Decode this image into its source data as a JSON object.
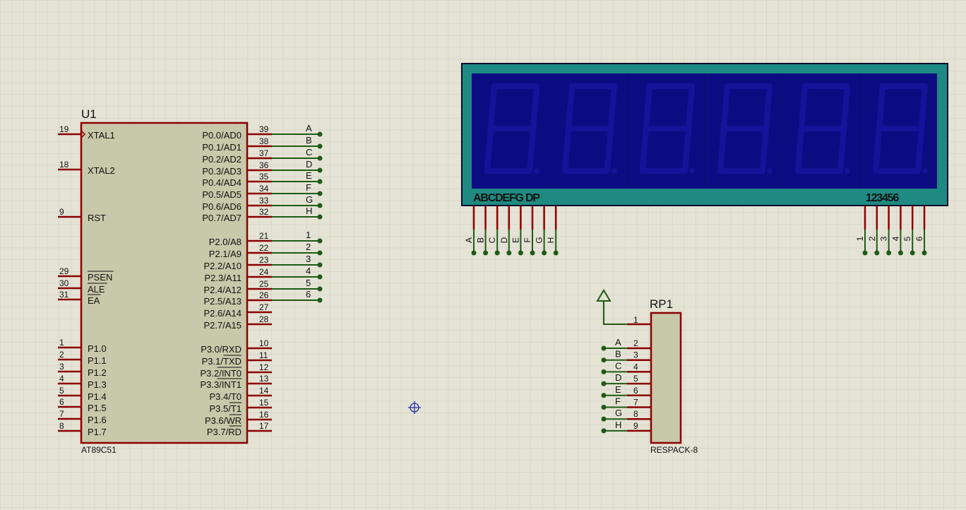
{
  "u1": {
    "ref": "U1",
    "part": "AT89C51",
    "left_pins": [
      {
        "num": "19",
        "name": "XTAL1"
      },
      {
        "num": "18",
        "name": "XTAL2"
      },
      {
        "num": "9",
        "name": "RST"
      },
      {
        "num": "29",
        "name": "PSEN"
      },
      {
        "num": "30",
        "name": "ALE"
      },
      {
        "num": "31",
        "name": "EA"
      },
      {
        "num": "1",
        "name": "P1.0"
      },
      {
        "num": "2",
        "name": "P1.1"
      },
      {
        "num": "3",
        "name": "P1.2"
      },
      {
        "num": "4",
        "name": "P1.3"
      },
      {
        "num": "5",
        "name": "P1.4"
      },
      {
        "num": "6",
        "name": "P1.5"
      },
      {
        "num": "7",
        "name": "P1.6"
      },
      {
        "num": "8",
        "name": "P1.7"
      }
    ],
    "right_pins": [
      {
        "num": "39",
        "name": "P0.0/AD0",
        "net": "A"
      },
      {
        "num": "38",
        "name": "P0.1/AD1",
        "net": "B"
      },
      {
        "num": "37",
        "name": "P0.2/AD2",
        "net": "C"
      },
      {
        "num": "36",
        "name": "P0.3/AD3",
        "net": "D"
      },
      {
        "num": "35",
        "name": "P0.4/AD4",
        "net": "E"
      },
      {
        "num": "34",
        "name": "P0.5/AD5",
        "net": "F"
      },
      {
        "num": "33",
        "name": "P0.6/AD6",
        "net": "G"
      },
      {
        "num": "32",
        "name": "P0.7/AD7",
        "net": "H"
      },
      {
        "num": "21",
        "name": "P2.0/A8",
        "net": "1"
      },
      {
        "num": "22",
        "name": "P2.1/A9",
        "net": "2"
      },
      {
        "num": "23",
        "name": "P2.2/A10",
        "net": "3"
      },
      {
        "num": "24",
        "name": "P2.3/A11",
        "net": "4"
      },
      {
        "num": "25",
        "name": "P2.4/A12",
        "net": "5"
      },
      {
        "num": "26",
        "name": "P2.5/A13",
        "net": "6"
      },
      {
        "num": "27",
        "name": "P2.6/A14",
        "net": ""
      },
      {
        "num": "28",
        "name": "P2.7/A15",
        "net": ""
      },
      {
        "num": "10",
        "name": "P3.0/RXD",
        "net": ""
      },
      {
        "num": "11",
        "name": "P3.1/TXD",
        "net": ""
      },
      {
        "num": "12",
        "name": "P3.2/INT0",
        "net": ""
      },
      {
        "num": "13",
        "name": "P3.3/INT1",
        "net": ""
      },
      {
        "num": "14",
        "name": "P3.4/T0",
        "net": ""
      },
      {
        "num": "15",
        "name": "P3.5/T1",
        "net": ""
      },
      {
        "num": "16",
        "name": "P3.6/WR",
        "net": ""
      },
      {
        "num": "17",
        "name": "P3.7/RD",
        "net": ""
      }
    ]
  },
  "display": {
    "segment_label": "ABCDEFG DP",
    "digit_label": "123456",
    "segment_nets": [
      "A",
      "B",
      "C",
      "D",
      "E",
      "F",
      "G",
      "H"
    ],
    "digit_nets": [
      "1",
      "2",
      "3",
      "4",
      "5",
      "6"
    ],
    "digit_count": 6,
    "colors": {
      "frame": "#1e8a82",
      "face": "#0c0c82",
      "segment": "#14149a"
    }
  },
  "rp1": {
    "ref": "RP1",
    "part": "RESPACK-8",
    "common_pin": "1",
    "pins": [
      {
        "num": "2",
        "net": "A"
      },
      {
        "num": "3",
        "net": "B"
      },
      {
        "num": "4",
        "net": "C"
      },
      {
        "num": "5",
        "net": "D"
      },
      {
        "num": "6",
        "net": "E"
      },
      {
        "num": "7",
        "net": "F"
      },
      {
        "num": "8",
        "net": "G"
      },
      {
        "num": "9",
        "net": "H"
      }
    ]
  },
  "colors": {
    "background": "#e4e3d5",
    "grid": "#cfcec0",
    "pin": "#8b0000",
    "wire": "#1e5a14",
    "body": "#c8c8aa",
    "cursor": "#2030b0"
  }
}
